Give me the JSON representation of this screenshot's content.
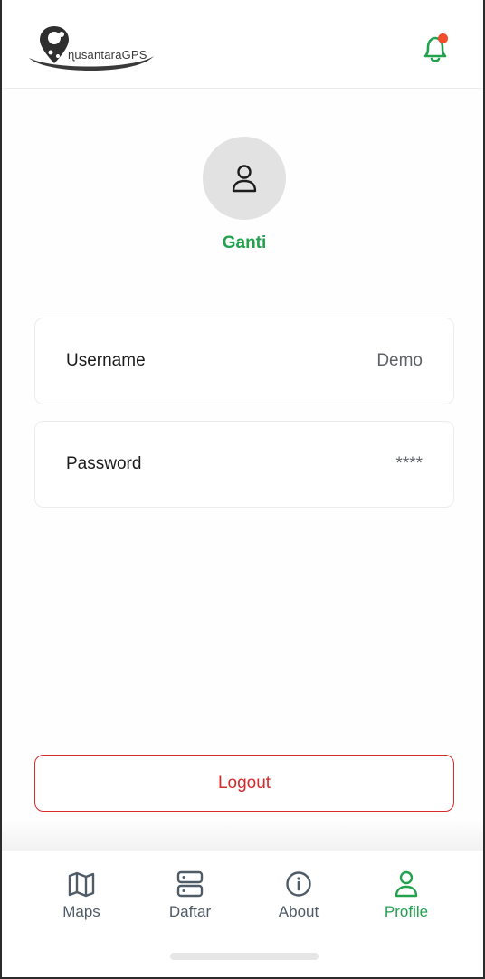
{
  "app": {
    "logo_text": "ɳusantaraGPS"
  },
  "header": {
    "notification_icon": "bell-icon",
    "notification_badge_color": "#f04e2c"
  },
  "profile": {
    "avatar_icon": "user-icon",
    "change_label": "Ganti"
  },
  "fields": {
    "username": {
      "label": "Username",
      "value": "Demo"
    },
    "password": {
      "label": "Password",
      "value": "****"
    }
  },
  "actions": {
    "logout_label": "Logout"
  },
  "nav": {
    "items": [
      {
        "label": "Maps",
        "icon": "map-icon",
        "active": false
      },
      {
        "label": "Daftar",
        "icon": "server-list-icon",
        "active": false
      },
      {
        "label": "About",
        "icon": "info-icon",
        "active": false
      },
      {
        "label": "Profile",
        "icon": "user-icon",
        "active": true
      }
    ]
  },
  "colors": {
    "accent": "#22a24d",
    "danger": "#d62b2b",
    "nav_inactive": "#4f5b66"
  }
}
